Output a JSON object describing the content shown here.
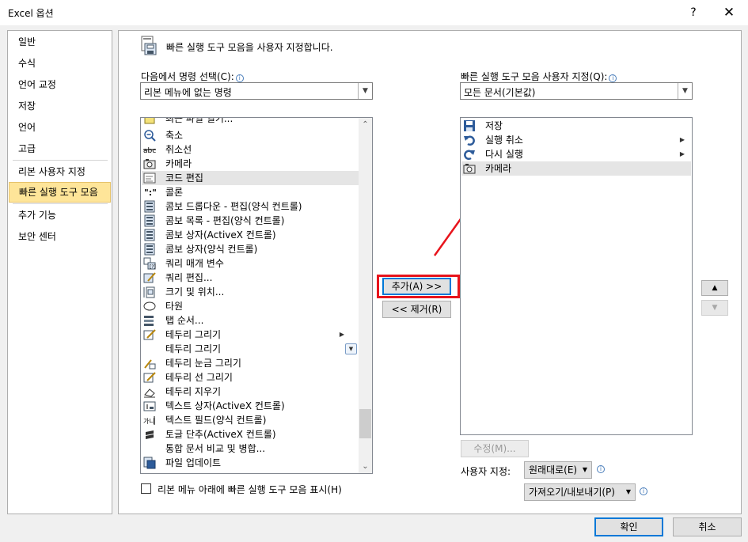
{
  "window": {
    "title": "Excel 옵션",
    "help_label": "?",
    "close_label": "✕"
  },
  "nav": {
    "items": [
      {
        "label": "일반"
      },
      {
        "label": "수식"
      },
      {
        "label": "언어 교정"
      },
      {
        "label": "저장"
      },
      {
        "label": "언어"
      },
      {
        "label": "고급"
      },
      {
        "label": "리본 사용자 지정"
      },
      {
        "label": "빠른 실행 도구 모음",
        "selected": true
      },
      {
        "label": "추가 기능"
      },
      {
        "label": "보안 센터"
      }
    ]
  },
  "header": {
    "icon": "quick-access-toolbar-icon",
    "text": "빠른 실행 도구 모음을 사용자 지정합니다."
  },
  "left": {
    "label": "다음에서 명령 선택(C):",
    "combo_value": "리본 메뉴에 없는 명령",
    "items": [
      {
        "label": "최근 파일 열기...",
        "icon": "recent-files-icon"
      },
      {
        "label": "축소",
        "icon": "zoom-out-icon"
      },
      {
        "label": "취소선",
        "icon": "strikethrough-icon"
      },
      {
        "label": "카메라",
        "icon": "camera-icon"
      },
      {
        "label": "코드 편집",
        "icon": "code-edit-icon",
        "highlighted": true
      },
      {
        "label": "콜론",
        "icon": "colon-icon"
      },
      {
        "label": "콤보 드롭다운 - 편집(양식 컨트롤)",
        "icon": "combo-dropdown-icon"
      },
      {
        "label": "콤보 목록 - 편집(양식 컨트롤)",
        "icon": "combo-list-icon"
      },
      {
        "label": "콤보 상자(ActiveX 컨트롤)",
        "icon": "combo-box-activex-icon"
      },
      {
        "label": "콤보 상자(양식 컨트롤)",
        "icon": "combo-box-form-icon"
      },
      {
        "label": "쿼리 매개 변수",
        "icon": "query-parameter-icon"
      },
      {
        "label": "쿼리 편집...",
        "icon": "query-edit-icon"
      },
      {
        "label": "크기 및 위치...",
        "icon": "size-position-icon"
      },
      {
        "label": "타원",
        "icon": "ellipse-icon"
      },
      {
        "label": "탭 순서...",
        "icon": "tab-order-icon"
      },
      {
        "label": "테두리 그리기",
        "icon": "draw-border-icon",
        "submenu": true
      },
      {
        "label": "테두리 그리기",
        "icon": "",
        "dropdown": true
      },
      {
        "label": "테두리 눈금 그리기",
        "icon": "draw-border-grid-icon"
      },
      {
        "label": "테두리 선 그리기",
        "icon": "draw-border-line-icon"
      },
      {
        "label": "테두리 지우기",
        "icon": "erase-border-icon"
      },
      {
        "label": "텍스트 상자(ActiveX 컨트롤)",
        "icon": "text-box-icon"
      },
      {
        "label": "텍스트 필드(양식 컨트롤)",
        "icon": "text-field-icon"
      },
      {
        "label": "토글 단추(ActiveX 컨트롤)",
        "icon": "toggle-button-icon"
      },
      {
        "label": "통합 문서 비교 및 병합...",
        "icon": ""
      },
      {
        "label": "파일 업데이트",
        "icon": "file-update-icon"
      }
    ],
    "checkbox_label": "리본 메뉴 아래에 빠른 실행 도구 모음 표시(H)"
  },
  "middle": {
    "add_label": "추가(A) >>",
    "remove_label": "<< 제거(R)"
  },
  "right": {
    "label": "빠른 실행 도구 모음 사용자 지정(Q):",
    "combo_value": "모든 문서(기본값)",
    "items": [
      {
        "label": "저장",
        "icon": "save-icon"
      },
      {
        "label": "실행 취소",
        "icon": "undo-icon",
        "submenu": true
      },
      {
        "label": "다시 실행",
        "icon": "redo-icon",
        "submenu": true
      },
      {
        "label": "카메라",
        "icon": "camera-icon",
        "highlighted": true
      }
    ],
    "modify_label": "수정(M)...",
    "customize_label": "사용자 지정:",
    "reset_label": "원래대로(E)",
    "import_export_label": "가져오기/내보내기(P)",
    "move_up_label": "▲",
    "move_down_label": "▼"
  },
  "footer": {
    "ok_label": "확인",
    "cancel_label": "취소"
  },
  "colors": {
    "selected_nav_bg": "#fee599",
    "annotation_red": "#e8141c",
    "default_button_border": "#0078d7"
  }
}
